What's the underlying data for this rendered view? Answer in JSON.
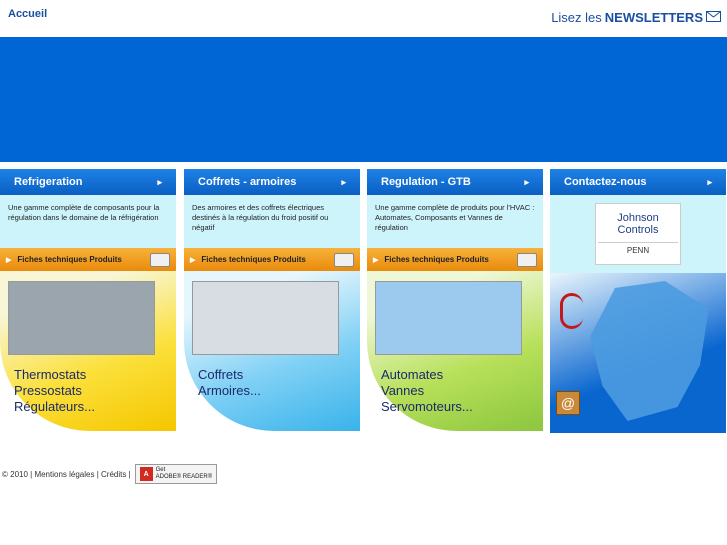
{
  "header": {
    "home_link": "Accueil",
    "newsletter_prefix": "Lisez les",
    "newsletter_bold": "NEWSLETTERS"
  },
  "columns": [
    {
      "title": "Refrigeration",
      "description": "Une gamme complète de composants pour la régulation dans le domaine de la réfrigération",
      "fiche": "Fiches techniques Produits",
      "promo_lines": [
        "Thermostats",
        "Pressostats",
        "Régulateurs..."
      ]
    },
    {
      "title": "Coffrets - armoires",
      "description": "Des armoires et des coffrets électriques destinés à la régulation du froid positif ou négatif",
      "fiche": "Fiches techniques Produits",
      "promo_lines": [
        "Coffrets",
        "Armoires..."
      ]
    },
    {
      "title": "Regulation - GTB",
      "description": "Une gamme complète de produits pour l'HVAC : Automates, Composants et Vannes de régulation",
      "fiche": "Fiches techniques Produits",
      "promo_lines": [
        "Automates",
        "Vannes",
        "Servomoteurs..."
      ]
    }
  ],
  "contact": {
    "title": "Contactez-nous",
    "logo_line1": "Johnson",
    "logo_line2": "Controls",
    "logo_sub": "PENN",
    "at_symbol": "@"
  },
  "footer": {
    "copyright": "© 2010 | Mentions légales | Crédits |",
    "adobe_line1": "Get",
    "adobe_line2": "ADOBE® READER®",
    "adobe_icon_text": "A"
  },
  "colors": {
    "banner": "#0066d6",
    "header_link": "#1a4fa0"
  }
}
